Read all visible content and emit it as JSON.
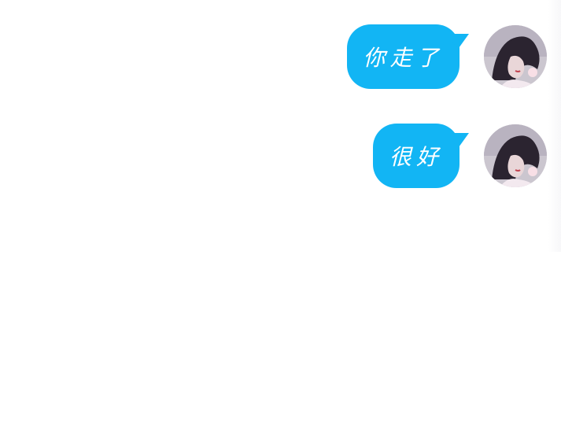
{
  "messages": [
    {
      "text": "你走了",
      "avatar_icon": "user-avatar-photo"
    },
    {
      "text": "很好",
      "avatar_icon": "user-avatar-photo"
    }
  ],
  "colors": {
    "bubble": "#12b5f4",
    "bubble_text": "#ffffff",
    "background": "#ffffff"
  }
}
